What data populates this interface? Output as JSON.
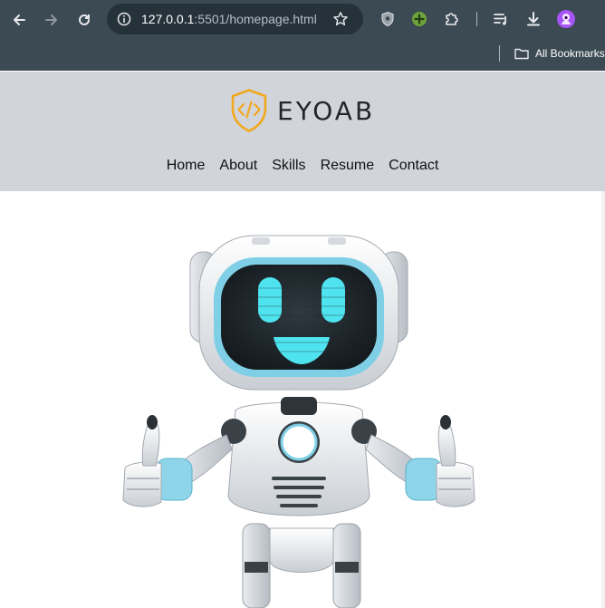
{
  "browser": {
    "url_host": "127.0.0.1",
    "url_path": ":5501/homepage.html",
    "bookmarks_label": "All Bookmarks",
    "icons": [
      "back-icon",
      "forward-icon",
      "reload-icon",
      "site-info-icon",
      "bookmark-star-icon",
      "shield-extension-icon",
      "green-plus-extension-icon",
      "extensions-puzzle-icon",
      "reading-list-icon",
      "download-icon",
      "profile-avatar-icon",
      "folder-icon"
    ],
    "colors": {
      "chrome": "#3c4a53",
      "omnibox": "#25323a",
      "avatar": "#a855f7"
    }
  },
  "site": {
    "logo_text": "EYOAB",
    "nav": [
      "Home",
      "About",
      "Skills",
      "Resume",
      "Contact"
    ],
    "colors": {
      "header_bg": "#d1d5db",
      "logo_accent": "#f2a81d"
    },
    "hero_image": "robot-thumbs-up"
  }
}
